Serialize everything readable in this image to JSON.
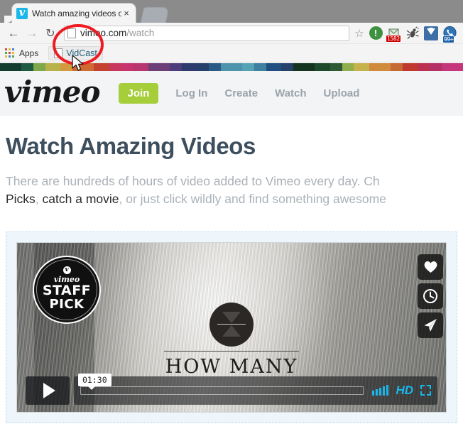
{
  "browser": {
    "tab": {
      "title": "Watch amazing videos on",
      "favicon": "vimeo-favicon",
      "close_label": "×"
    },
    "new_tab_label": "+",
    "nav": {
      "back": "←",
      "forward": "→",
      "reload": "↻"
    },
    "omnibox": {
      "url_domain": "vimeo.com",
      "url_path": "/watch",
      "star": "☆"
    },
    "extensions": [
      {
        "name": "green-exclamation-icon",
        "glyph": "!",
        "badge": ""
      },
      {
        "name": "mail-extension-icon",
        "glyph": "",
        "badge": "1582"
      },
      {
        "name": "bug-extension-icon",
        "glyph": "",
        "badge": ""
      },
      {
        "name": "download-extension-icon",
        "glyph": "",
        "badge": ""
      },
      {
        "name": "phone-extension-icon",
        "glyph": "",
        "badge": "99+"
      }
    ],
    "bookmarks": {
      "apps_label": "Apps",
      "items": [
        {
          "label": "VidCast"
        }
      ]
    },
    "annotation": {
      "shape": "red-ellipse",
      "color": "#ee1b22",
      "target": "VidCast"
    }
  },
  "site": {
    "stripe_colors": [
      "#123c2e",
      "#1d5a42",
      "#7fa84a",
      "#b9b24a",
      "#d39a3f",
      "#cf6a32",
      "#c5412f",
      "#c7365c",
      "#c8336e",
      "#b8366f",
      "#6b3e78",
      "#4b3d7a",
      "#2d3a6e",
      "#24406b",
      "#2b5b85",
      "#4d93ab",
      "#56a3b6",
      "#3f7fa0",
      "#1f4f80",
      "#24406b",
      "#15331f",
      "#1d4a2b",
      "#2e5a33",
      "#8fae4c",
      "#c6b24b",
      "#d08a3c",
      "#c66a33",
      "#c0392f",
      "#bb2f50",
      "#b42f66",
      "#c5357a"
    ],
    "logo": "vimeo",
    "nav": [
      {
        "label": "Join",
        "type": "button",
        "color": "#a5ce3a"
      },
      {
        "label": "Log In",
        "type": "link"
      },
      {
        "label": "Create",
        "type": "link"
      },
      {
        "label": "Watch",
        "type": "link"
      },
      {
        "label": "Upload",
        "type": "link"
      }
    ],
    "page_title": "Watch Amazing Videos",
    "lede": {
      "line1_pre": "There are hundreds of hours of video added to Vimeo every day. Ch",
      "line2_link1": "Picks",
      "line2_sep1": ", ",
      "line2_link2": "catch a movie",
      "line2_post": ", or just click wildly and find something awesome"
    },
    "video": {
      "staff_pick": {
        "brand": "vimeo",
        "line1": "STAFF",
        "line2": "PICK"
      },
      "title": "HOW MANY",
      "actions": [
        {
          "name": "like-icon",
          "glyph": "heart"
        },
        {
          "name": "watch-later-icon",
          "glyph": "clock"
        },
        {
          "name": "share-icon",
          "glyph": "paper-plane"
        }
      ],
      "controls": {
        "play_label": "Play",
        "duration": "01:30",
        "quality_badge": "HD",
        "volume_label": "Volume",
        "fullscreen_label": "Fullscreen"
      }
    }
  }
}
